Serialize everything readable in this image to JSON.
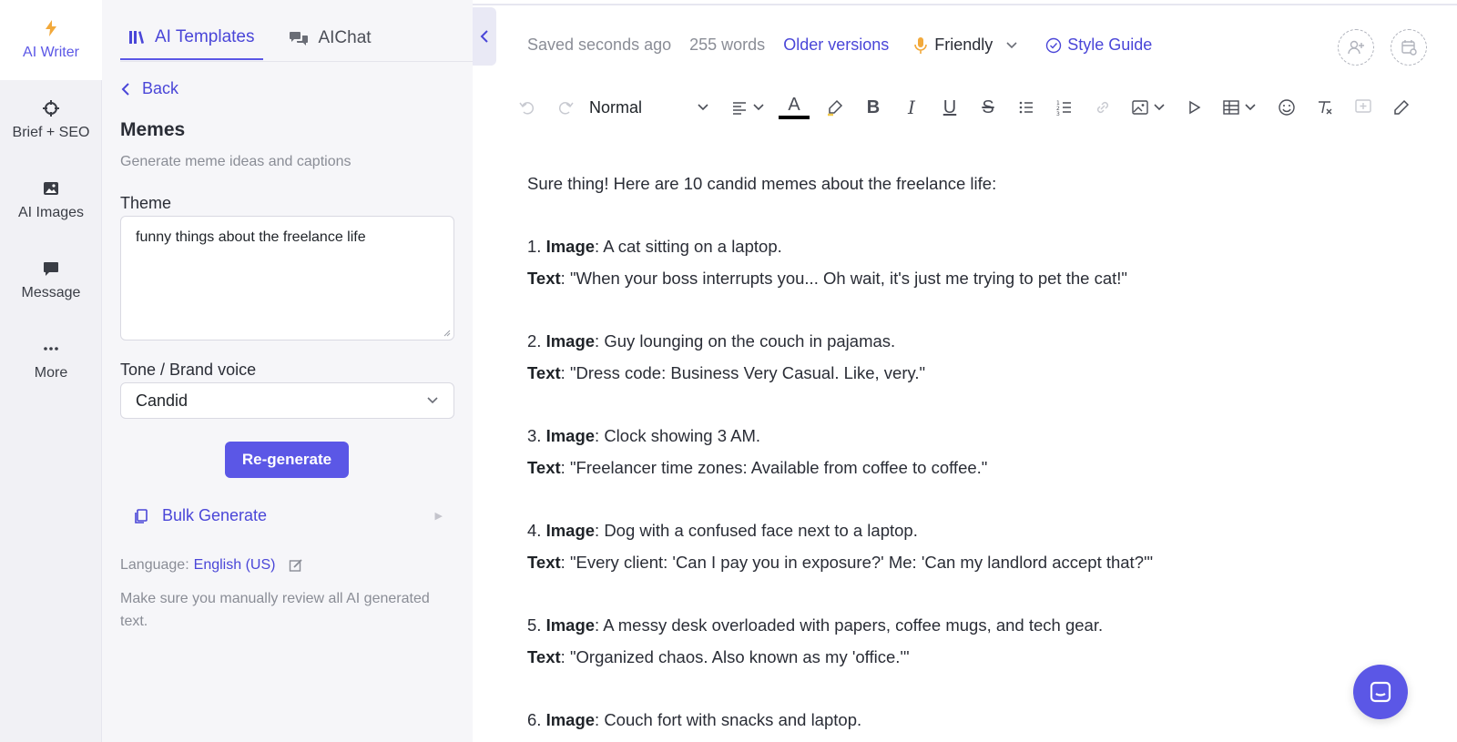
{
  "rail": {
    "items": [
      {
        "label": "AI Writer",
        "icon": "lightning-icon"
      },
      {
        "label": "Brief + SEO",
        "icon": "crosshair-icon"
      },
      {
        "label": "AI Images",
        "icon": "image-icon"
      },
      {
        "label": "Message",
        "icon": "message-icon"
      },
      {
        "label": "More",
        "icon": "more-dots-icon"
      }
    ]
  },
  "panel": {
    "tabs": [
      {
        "label": "AI Templates",
        "icon": "books-icon"
      },
      {
        "label": "AIChat",
        "icon": "chat-bubbles-icon"
      }
    ],
    "back_label": "Back",
    "template_title": "Memes",
    "template_subtitle": "Generate meme ideas and captions",
    "theme_label": "Theme",
    "theme_value": "funny things about the freelance life",
    "tone_label": "Tone / Brand voice",
    "tone_value": "Candid",
    "regenerate_label": "Re-generate",
    "bulk_label": "Bulk Generate",
    "language_label": "Language:",
    "language_value": "English (US)",
    "disclaimer": "Make sure you manually review all AI generated text."
  },
  "status": {
    "saved": "Saved seconds ago",
    "words": "255 words",
    "older_versions": "Older versions",
    "tone": "Friendly",
    "style_guide": "Style Guide"
  },
  "toolbar": {
    "paragraph_style": "Normal",
    "text_color": "#000000"
  },
  "document": {
    "intro": "Sure thing! Here are 10 candid memes about the freelance life:",
    "image_label": "Image",
    "text_label": "Text",
    "memes": [
      {
        "num": "1.",
        "image": ": A cat sitting on a laptop.",
        "text": ": \"When your boss interrupts you... Oh wait, it's just me trying to pet the cat!\""
      },
      {
        "num": "2.",
        "image": ": Guy lounging on the couch in pajamas.",
        "text": ": \"Dress code: Business Very Casual. Like, very.\""
      },
      {
        "num": "3.",
        "image": ": Clock showing 3 AM.",
        "text": ": \"Freelancer time zones: Available from coffee to coffee.\""
      },
      {
        "num": "4.",
        "image": ": Dog with a confused face next to a laptop.",
        "text": ": \"Every client: 'Can I pay you in exposure?' Me: 'Can my landlord accept that?'\""
      },
      {
        "num": "5.",
        "image": ": A messy desk overloaded with papers, coffee mugs, and tech gear.",
        "text": ": \"Organized chaos. Also known as my 'office.'\""
      },
      {
        "num": "6.",
        "image": ": Couch fort with snacks and laptop.",
        "text": ""
      }
    ]
  },
  "colors": {
    "accent": "#5b57e6",
    "rail_bg": "#f1f1f5",
    "panel_bg": "#f6f6f9"
  }
}
